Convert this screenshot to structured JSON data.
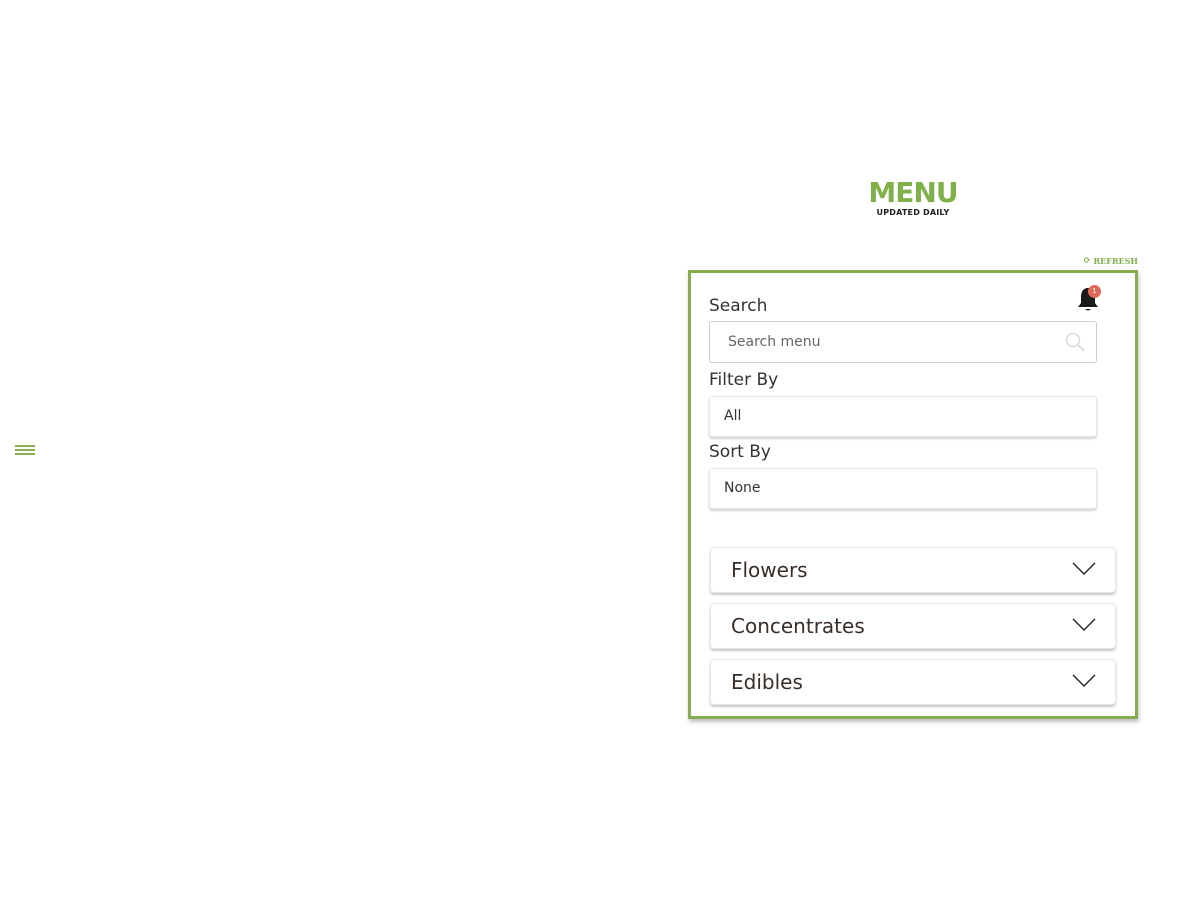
{
  "nav": {
    "menu_toggle_icon": "hamburger-icon"
  },
  "brand": {
    "title": "MENU",
    "subtitle": "UPDATED DAILY",
    "accent_color": "#7fb04a"
  },
  "toolbar": {
    "refresh_icon": "refresh-icon",
    "refresh_label": "REFRESH"
  },
  "panel": {
    "border_color": "#86ad50",
    "notifications": {
      "icon": "bell-icon",
      "count": "1",
      "badge_color": "#e06a58"
    },
    "search": {
      "label": "Search",
      "placeholder": "Search menu",
      "value": "",
      "icon": "search-icon"
    },
    "filter": {
      "label": "Filter By",
      "selected": "All"
    },
    "sort": {
      "label": "Sort By",
      "selected": "None"
    },
    "categories": [
      {
        "label": "Flowers",
        "icon": "chevron-down-icon"
      },
      {
        "label": "Concentrates",
        "icon": "chevron-down-icon"
      },
      {
        "label": "Edibles",
        "icon": "chevron-down-icon"
      }
    ]
  }
}
